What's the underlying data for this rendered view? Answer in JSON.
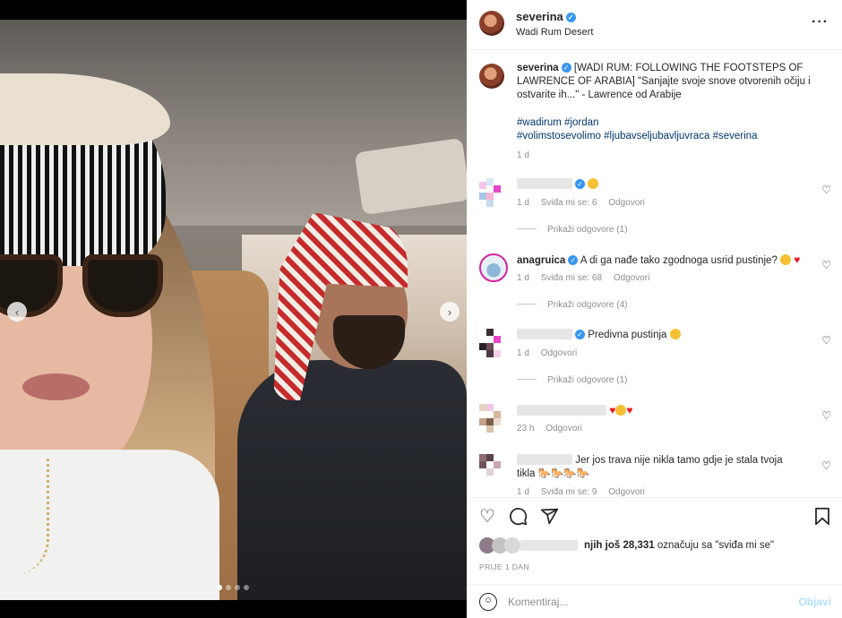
{
  "post": {
    "username": "severina",
    "location": "Wadi Rum Desert",
    "more_icon": "more-horizontal-icon"
  },
  "caption": {
    "username": "severina",
    "text": "[WADI RUM: FOLLOWING THE FOOTSTEPS OF LAWRENCE OF ARABIA] \"Sanjajte svoje snove otvorenih očiju i ostvarite ih...\" - Lawrence od Arabije",
    "tags_line1": "#wadirum #jordan",
    "tags_line2": "#volimstosevolimo #ljubavseljubavljuvraca #severina",
    "time": "1 d"
  },
  "comments": [
    {
      "username": "",
      "text": "",
      "time": "1 d",
      "likes": "Sviđa mi se: 6",
      "reply": "Odgovori",
      "replies": "Prikaži odgovore (1)"
    },
    {
      "username": "anagruica",
      "text": "A di ga nađe tako zgodnoga usrid pustinje?",
      "time": "1 d",
      "likes": "Sviđa mi se: 68",
      "reply": "Odgovori",
      "replies": "Prikaži odgovore (4)"
    },
    {
      "username": "",
      "text": "Predivna pustinja",
      "time": "1 d",
      "reply": "Odgovori",
      "replies": "Prikaži odgovore (1)"
    },
    {
      "username": "",
      "text": "",
      "time": "23 h",
      "reply": "Odgovori"
    },
    {
      "username": "",
      "text": "Jer jos trava nije nikla tamo gdje je stala tvoja",
      "text2": "tikla",
      "time": "1 d",
      "likes": "Sviđa mi se: 9",
      "reply": "Odgovori"
    }
  ],
  "actions": {
    "like_icon": "heart-icon",
    "comment_icon": "comment-icon",
    "share_icon": "share-icon",
    "save_icon": "bookmark-icon"
  },
  "likes": {
    "prefix": "njih još",
    "count": "28,331",
    "suffix": "označuju sa \"sviđa mi se\""
  },
  "date": "PRIJE 1 DAN",
  "add_comment": {
    "placeholder": "Komentiraj...",
    "post_label": "Objavi"
  },
  "carousel": {
    "current": 1,
    "total": 4
  },
  "colors": {
    "link": "#00376b",
    "verified": "#3897f0",
    "post_disabled": "#b2dffc",
    "heart": "#ed1c24"
  }
}
